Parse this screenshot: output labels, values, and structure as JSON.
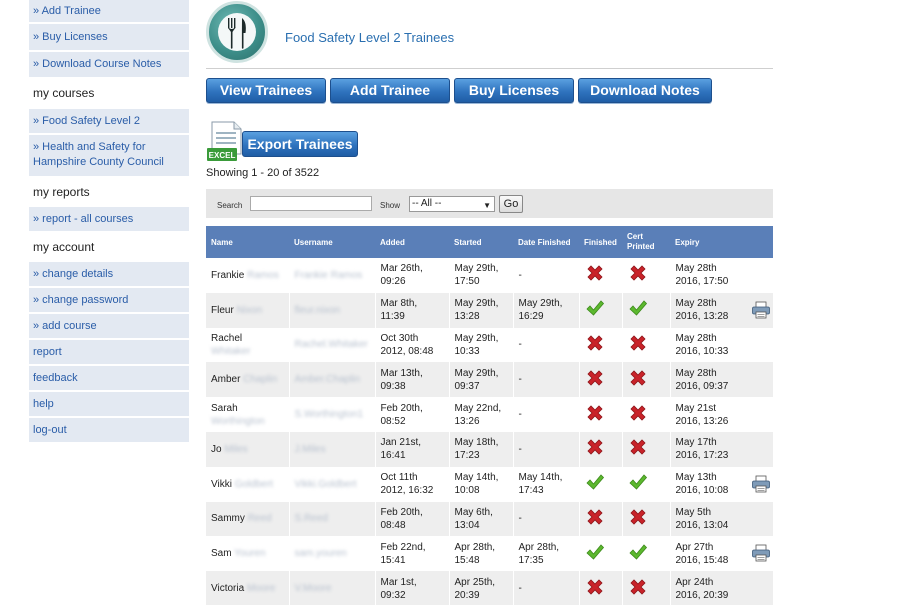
{
  "sidebar": {
    "links_top": [
      {
        "label": "» Add Trainee"
      },
      {
        "label": "» Buy Licenses"
      },
      {
        "label": "» Download Course Notes"
      }
    ],
    "courses_heading": "my courses",
    "course_links": [
      {
        "label": "» Food Safety Level 2"
      },
      {
        "label": "» Health and Safety for Hampshire County Council"
      }
    ],
    "reports_heading": "my reports",
    "report_links": [
      {
        "label": "» report - all courses"
      }
    ],
    "account_heading": "my account",
    "account_links": [
      {
        "label": "» change details"
      },
      {
        "label": "» change password"
      },
      {
        "label": "» add course"
      },
      {
        "label": "report"
      },
      {
        "label": "feedback"
      },
      {
        "label": "help"
      },
      {
        "label": "log-out"
      }
    ]
  },
  "header": {
    "course_title": "Food Safety Level 2 Trainees",
    "logo_icon": "fork-knife-icon"
  },
  "actions": {
    "view_trainees": "View Trainees",
    "add_trainee": "Add Trainee",
    "buy_licenses": "Buy Licenses",
    "download_notes": "Download Notes",
    "export_trainees": "Export Trainees",
    "excel_label": "EXCEL"
  },
  "showing": "Showing 1 - 20 of 3522",
  "filter": {
    "search_label": "Search",
    "search_value": "",
    "show_label": "Show",
    "show_selected": "-- All --",
    "go_label": "Go"
  },
  "table": {
    "columns": [
      "Name",
      "Username",
      "Added",
      "Started",
      "Date Finished",
      "Finished",
      "Cert Printed",
      "Expiry"
    ],
    "rows": [
      {
        "first": "Frankie",
        "last": "Ramos",
        "username": "Frankie Ramos",
        "added": [
          "Mar 26th,",
          "09:26"
        ],
        "started": [
          "May 29th,",
          "17:50"
        ],
        "finished_date": [
          "-"
        ],
        "finished": false,
        "cert": false,
        "expiry": [
          "May 28th",
          "2016, 17:50"
        ],
        "printer": false
      },
      {
        "first": "Fleur",
        "last": "Nixon",
        "username": "fleur.nixon",
        "added": [
          "Mar 8th,",
          "11:39"
        ],
        "started": [
          "May 29th,",
          "13:28"
        ],
        "finished_date": [
          "May 29th,",
          "16:29"
        ],
        "finished": true,
        "cert": true,
        "expiry": [
          "May 28th",
          "2016, 13:28"
        ],
        "printer": true
      },
      {
        "first": "Rachel",
        "last": "Whitaker",
        "username": "Rachel.Whitaker",
        "added": [
          "Oct 30th",
          "2012, 08:48"
        ],
        "started": [
          "May 29th,",
          "10:33"
        ],
        "finished_date": [
          "-"
        ],
        "finished": false,
        "cert": false,
        "expiry": [
          "May 28th",
          "2016, 10:33"
        ],
        "printer": false
      },
      {
        "first": "Amber",
        "last": "Chaplin",
        "username": "Amber.Chaplin",
        "added": [
          "Mar 13th,",
          "09:38"
        ],
        "started": [
          "May 29th,",
          "09:37"
        ],
        "finished_date": [
          "-"
        ],
        "finished": false,
        "cert": false,
        "expiry": [
          "May 28th",
          "2016, 09:37"
        ],
        "printer": false
      },
      {
        "first": "Sarah",
        "last": "Worthington",
        "username": "S.Worthington1",
        "added": [
          "Feb 20th,",
          "08:52"
        ],
        "started": [
          "May 22nd,",
          "13:26"
        ],
        "finished_date": [
          "-"
        ],
        "finished": false,
        "cert": false,
        "expiry": [
          "May 21st",
          "2016, 13:26"
        ],
        "printer": false
      },
      {
        "first": "Jo",
        "last": "Miles",
        "username": "J.Miles",
        "added": [
          "Jan 21st,",
          "16:41"
        ],
        "started": [
          "May 18th,",
          "17:23"
        ],
        "finished_date": [
          "-"
        ],
        "finished": false,
        "cert": false,
        "expiry": [
          "May 17th",
          "2016, 17:23"
        ],
        "printer": false
      },
      {
        "first": "Vikki",
        "last": "Goldbert",
        "username": "Vikki.Goldbert",
        "added": [
          "Oct 11th",
          "2012, 16:32"
        ],
        "started": [
          "May 14th,",
          "10:08"
        ],
        "finished_date": [
          "May 14th,",
          "17:43"
        ],
        "finished": true,
        "cert": true,
        "expiry": [
          "May 13th",
          "2016, 10:08"
        ],
        "printer": true
      },
      {
        "first": "Sammy",
        "last": "Reed",
        "username": "S.Reed",
        "added": [
          "Feb 20th,",
          "08:48"
        ],
        "started": [
          "May 6th,",
          "13:04"
        ],
        "finished_date": [
          "-"
        ],
        "finished": false,
        "cert": false,
        "expiry": [
          "May 5th",
          "2016, 13:04"
        ],
        "printer": false
      },
      {
        "first": "Sam",
        "last": "Youren",
        "username": "sam.youren",
        "added": [
          "Feb 22nd,",
          "15:41"
        ],
        "started": [
          "Apr 28th,",
          "15:48"
        ],
        "finished_date": [
          "Apr 28th,",
          "17:35"
        ],
        "finished": true,
        "cert": true,
        "expiry": [
          "Apr 27th",
          "2016, 15:48"
        ],
        "printer": true
      },
      {
        "first": "Victoria",
        "last": "Moore",
        "username": "V.Moore",
        "added": [
          "Mar 1st,",
          "09:32"
        ],
        "started": [
          "Apr 25th,",
          "20:39"
        ],
        "finished_date": [
          "-"
        ],
        "finished": false,
        "cert": false,
        "expiry": [
          "Apr 24th",
          "2016, 20:39"
        ],
        "printer": false
      }
    ]
  },
  "colors": {
    "header_blue": "#5a7fb8",
    "link_blue": "#2a5da8",
    "button_blue": "#2f73be",
    "check_green": "#5cb82e",
    "cross_red": "#c9232a"
  }
}
